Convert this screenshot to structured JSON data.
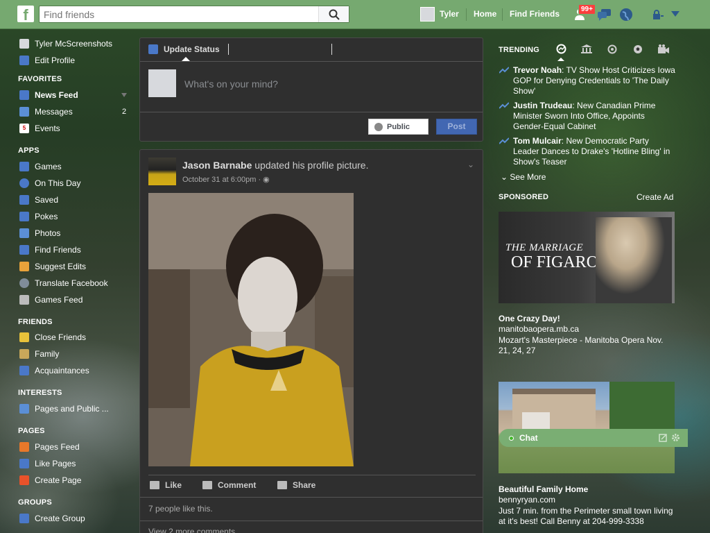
{
  "topbar": {
    "logo": "f",
    "search_placeholder": "Find friends",
    "user_name": "Tyler",
    "home": "Home",
    "find_friends": "Find Friends",
    "notif_badge": "99+"
  },
  "leftnav": {
    "profile_name": "Tyler McScreenshots",
    "edit_profile": "Edit Profile",
    "favorites_heading": "FAVORITES",
    "favorites": [
      {
        "label": "News Feed",
        "icon": "news-feed-icon"
      },
      {
        "label": "Messages",
        "icon": "messages-icon",
        "count": "2"
      },
      {
        "label": "Events",
        "icon": "events-icon",
        "date": "5"
      }
    ],
    "apps_heading": "APPS",
    "apps": [
      {
        "label": "Games"
      },
      {
        "label": "On This Day"
      },
      {
        "label": "Saved"
      },
      {
        "label": "Pokes"
      },
      {
        "label": "Photos"
      },
      {
        "label": "Find Friends"
      },
      {
        "label": "Suggest Edits"
      },
      {
        "label": "Translate Facebook"
      },
      {
        "label": "Games Feed"
      }
    ],
    "friends_heading": "FRIENDS",
    "friends": [
      {
        "label": "Close Friends"
      },
      {
        "label": "Family"
      },
      {
        "label": "Acquaintances"
      }
    ],
    "interests_heading": "INTERESTS",
    "interests": [
      {
        "label": "Pages and Public ..."
      }
    ],
    "pages_heading": "PAGES",
    "pages": [
      {
        "label": "Pages Feed"
      },
      {
        "label": "Like Pages"
      },
      {
        "label": "Create Page"
      }
    ],
    "groups_heading": "GROUPS",
    "groups": [
      {
        "label": "Create Group"
      }
    ]
  },
  "composer": {
    "tab_label": "Update Status",
    "placeholder": "What's on your mind?",
    "privacy": "Public",
    "post_button": "Post"
  },
  "post": {
    "author": "Jason Barnabe",
    "action": " updated his profile picture.",
    "time": "October 31 at 6:00pm · ",
    "like": "Like",
    "comment": "Comment",
    "share": "Share",
    "likes_text": "7 people like this.",
    "more_comments": "View 2 more comments"
  },
  "right": {
    "trending_heading": "TRENDING",
    "trending": [
      {
        "name": "Trevor Noah",
        "text": ": TV Show Host Criticizes Iowa GOP for Denying Credentials to 'The Daily Show'"
      },
      {
        "name": "Justin Trudeau",
        "text": ": New Canadian Prime Minister Sworn Into Office, Appoints Gender-Equal Cabinet"
      },
      {
        "name": "Tom Mulcair",
        "text": ": New Democratic Party Leader Dances to Drake's 'Hotline Bling' in Show's Teaser"
      }
    ],
    "see_more": "See More",
    "sponsored_heading": "SPONSORED",
    "create_ad": "Create Ad",
    "ad1": {
      "image_text_1": "THE MARRIAGE",
      "image_text_2": "OF FIGARO",
      "title": "One Crazy Day!",
      "domain": "manitobaopera.mb.ca",
      "desc": "Mozart's Masterpiece - Manitoba Opera Nov. 21, 24, 27"
    },
    "ad2": {
      "title": "Beautiful Family Home",
      "domain": "bennyryan.com",
      "desc": "Just 7 min. from the Perimeter small town living at it's best! Call Benny at 204-999-3338"
    },
    "chat": "Chat"
  }
}
